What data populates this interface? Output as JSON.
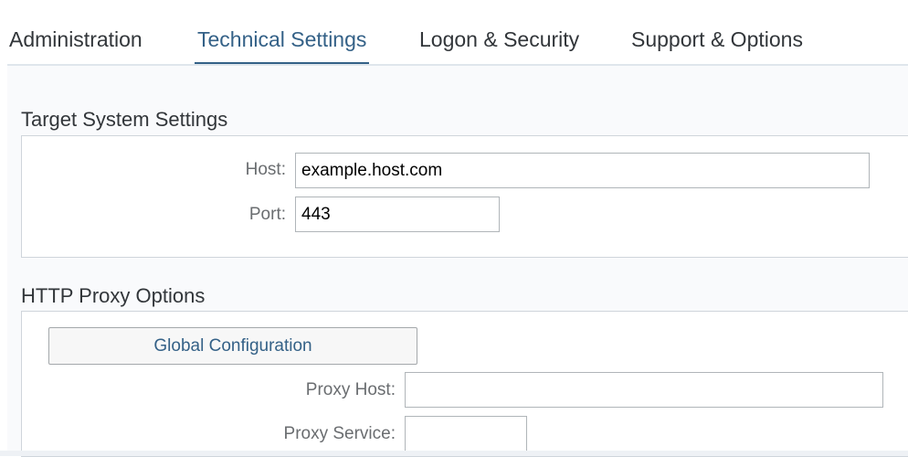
{
  "tabs": [
    {
      "label": "Administration"
    },
    {
      "label": "Technical Settings"
    },
    {
      "label": "Logon & Security"
    },
    {
      "label": "Support & Options"
    }
  ],
  "active_tab": "Technical Settings",
  "target_system": {
    "title": "Target System Settings",
    "host_label": "Host:",
    "host_value": "example.host.com",
    "port_label": "Port:",
    "port_value": "443"
  },
  "http_proxy": {
    "title": "HTTP Proxy Options",
    "global_config_label": "Global Configuration",
    "proxy_host_label": "Proxy Host:",
    "proxy_host_value": "",
    "proxy_service_label": "Proxy Service:",
    "proxy_service_value": ""
  },
  "colors": {
    "accent": "#346187",
    "panel_border": "#cfd5db",
    "content_bg": "#f9fafc"
  }
}
